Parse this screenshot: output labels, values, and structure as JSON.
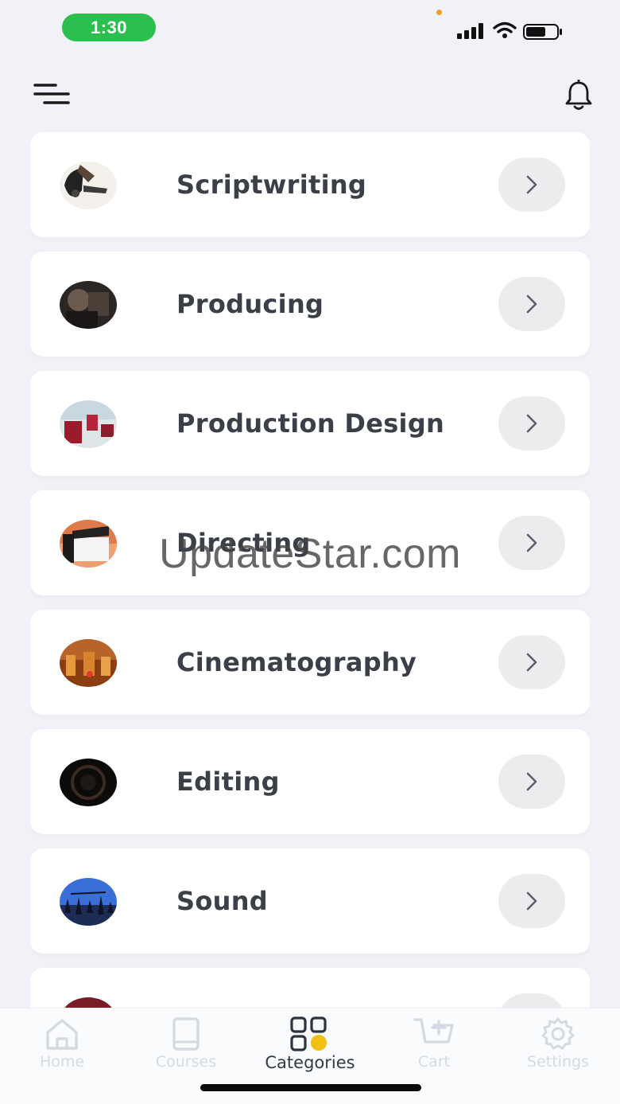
{
  "status_bar": {
    "time": "1:30",
    "signal_icon": "cellular-signal-icon",
    "wifi_icon": "wifi-icon",
    "battery_icon": "battery-icon",
    "time_pill_color": "#2bbf4f"
  },
  "header": {
    "menu_icon": "menu-icon",
    "notifications_icon": "bell-icon"
  },
  "categories": [
    {
      "label": "Scriptwriting",
      "thumb": "scriptwriting-thumbnail"
    },
    {
      "label": "Producing",
      "thumb": "producing-thumbnail"
    },
    {
      "label": "Production Design",
      "thumb": "production-design-thumbnail"
    },
    {
      "label": "Directing",
      "thumb": "directing-thumbnail"
    },
    {
      "label": "Cinematography",
      "thumb": "cinematography-thumbnail"
    },
    {
      "label": "Editing",
      "thumb": "editing-thumbnail"
    },
    {
      "label": "Sound",
      "thumb": "sound-thumbnail"
    },
    {
      "label": "",
      "thumb": "partial-thumbnail"
    }
  ],
  "watermark": "UpdateStar.com",
  "bottom_nav": {
    "items": [
      {
        "label": "Home",
        "icon": "home-icon",
        "active": false
      },
      {
        "label": "Courses",
        "icon": "book-icon",
        "active": false
      },
      {
        "label": "Categories",
        "icon": "categories-grid-icon",
        "active": true
      },
      {
        "label": "Cart",
        "icon": "cart-icon",
        "active": false
      },
      {
        "label": "Settings",
        "icon": "gear-icon",
        "active": false
      }
    ],
    "active_accent": "#f2c012",
    "inactive_color": "#d5d9e2"
  }
}
